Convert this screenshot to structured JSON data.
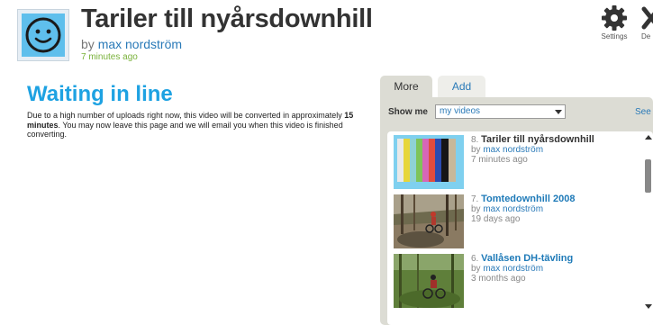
{
  "video": {
    "title": "Tariler till nyårsdownhill",
    "by_prefix": "by",
    "author": "max nordström",
    "time_ago": "7 minutes ago"
  },
  "toolbar": {
    "settings_label": "Settings",
    "delete_label": "De"
  },
  "status": {
    "heading": "Waiting in line",
    "message_before": "Due to a high number of uploads right now, this video will be converted in approximately ",
    "message_bold": "15 minutes",
    "message_after": ". You may now leave this page and we will email you when this video is finished converting."
  },
  "sidebar": {
    "tabs": [
      {
        "label": "More",
        "active": true
      },
      {
        "label": "Add",
        "active": false
      }
    ],
    "filter_label": "Show me",
    "filter_selected": "my videos",
    "see_link": "See",
    "videos": [
      {
        "number": "8.",
        "title": "Tariler till nyårsdownhill",
        "by_prefix": "by",
        "author": "max nordström",
        "age": "7 minutes ago"
      },
      {
        "number": "7.",
        "title": "Tomtedownhill 2008",
        "by_prefix": "by",
        "author": "max nordström",
        "age": "19 days ago"
      },
      {
        "number": "6.",
        "title": "Vallåsen DH-tävling",
        "by_prefix": "by",
        "author": "max nordström",
        "age": "3 months ago"
      }
    ]
  },
  "icons": {
    "avatar": "smiley-face-avatar",
    "settings": "gear-icon",
    "delete": "close-icon"
  },
  "colors": {
    "heading_blue": "#1ea2e2",
    "link_blue": "#2a7ab8",
    "time_green": "#7ab23b",
    "panel_gray": "#dcdcd4"
  }
}
